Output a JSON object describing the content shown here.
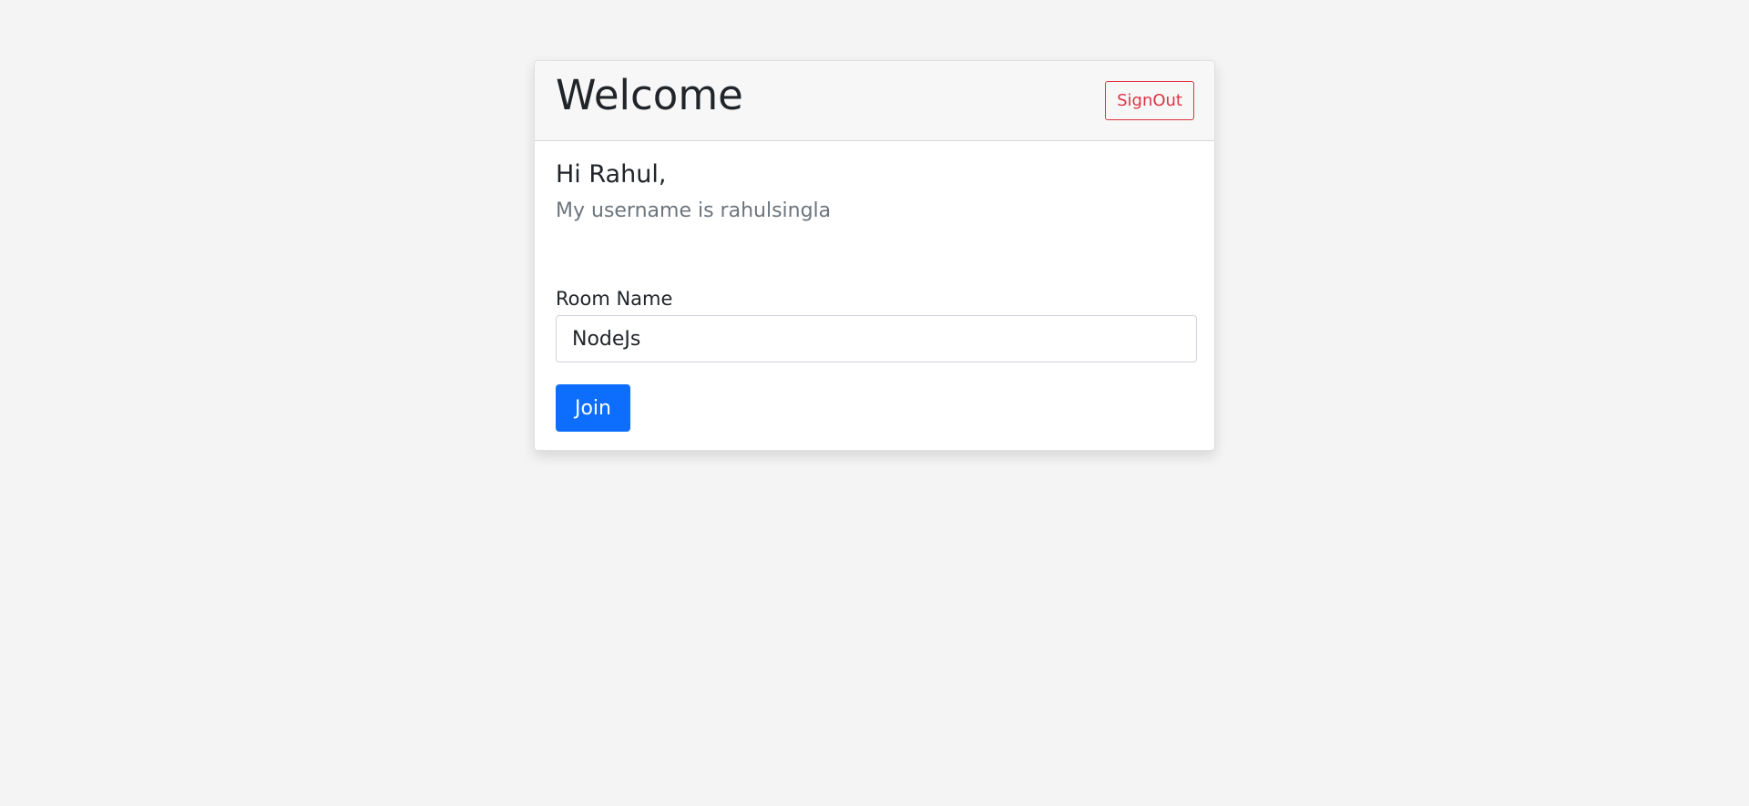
{
  "card": {
    "title": "Welcome",
    "signout_label": "SignOut"
  },
  "profile": {
    "greeting": "Hi Rahul,",
    "subtitle": "My username is rahulsingla"
  },
  "form": {
    "room_label": "Room Name",
    "room_value": "NodeJs",
    "join_label": "Join"
  },
  "colors": {
    "primary": "#0d6efd",
    "danger": "#dc3545",
    "muted": "#6c757d",
    "background": "#f4f4f4"
  }
}
